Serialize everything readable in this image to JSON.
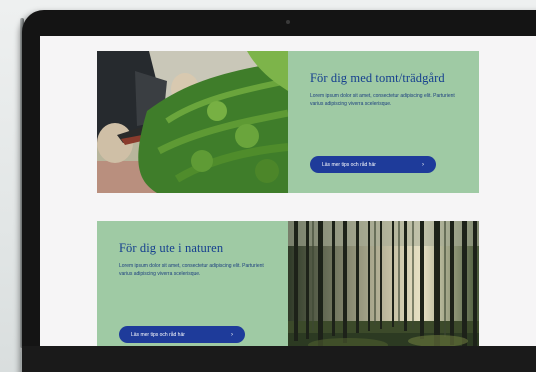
{
  "cards": [
    {
      "heading": "För dig med tomt/trädgård",
      "body": "Lorem ipsum dolor sit amet, consectetur adipiscing elit. Parturient varius adipiscing viverra scelerisque.",
      "button_label": "Läs mer tips och råd här",
      "button_icon": "chevron-right-icon",
      "image": "gardener-pruning-shrub-photo"
    },
    {
      "heading": "För dig ute i naturen",
      "body": "Lorem ipsum dolor sit amet, consectetur adipiscing elit. Parturient varius adipiscing viverra scelerisque.",
      "button_label": "Läs mer tips och råd här",
      "button_icon": "chevron-right-icon",
      "image": "pine-forest-sunlight-photo"
    }
  ],
  "colors": {
    "card_background": "#9fcaa4",
    "heading_text": "#153f8f",
    "button_background": "#1e3b9a",
    "page_background": "#f6f5f6",
    "device_bezel": "#141414"
  }
}
